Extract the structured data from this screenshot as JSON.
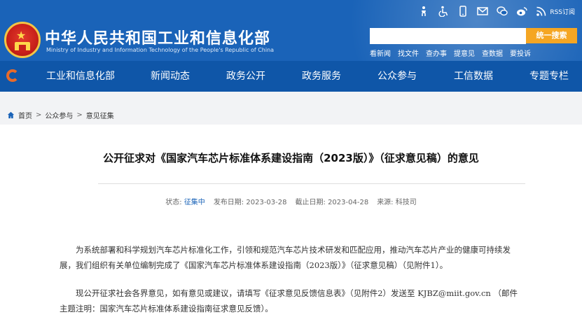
{
  "header": {
    "title": "中华人民共和国工业和信息化部",
    "subtitle": "Ministry of Industry and Information Technology of the People's Republic of China",
    "top_icons": [
      "elder-care-icon",
      "accessibility-icon",
      "mobile-icon",
      "email-icon",
      "wechat-icon",
      "weibo-icon",
      "rss-icon"
    ],
    "rss_label": "RSS订阅",
    "search": {
      "placeholder": "",
      "button_label": "统一搜索"
    },
    "quick_links": [
      "看新闻",
      "找文件",
      "查办事",
      "提意见",
      "查数据",
      "要投诉"
    ],
    "accent_color": "#f5a623",
    "header_color": "#1a63b8"
  },
  "nav": {
    "items": [
      "工业和信息化部",
      "新闻动态",
      "政务公开",
      "政务服务",
      "公众参与",
      "工信数据",
      "专题专栏"
    ],
    "color": "#0f56a8"
  },
  "breadcrumb": [
    "首页",
    "公众参与",
    "意见征集"
  ],
  "article": {
    "title": "公开征求对《国家汽车芯片标准体系建设指南（2023版）》（征求意见稿）的意见",
    "meta": {
      "status_label": "状态:",
      "status_value": "征集中",
      "publish_label": "发布日期:",
      "publish_date": "2023-03-28",
      "deadline_label": "截止日期:",
      "deadline_date": "2023-04-28",
      "source_label": "来源:",
      "source_value": "科技司"
    },
    "paragraphs": [
      "为系统部署和科学规划汽车芯片标准化工作，引领和规范汽车芯片技术研发和匹配应用，推动汽车芯片产业的健康可持续发展，我们组织有关单位编制完成了《国家汽车芯片标准体系建设指南（2023版）》（征求意见稿）（见附件1）。",
      "现公开征求社会各界意见，如有意见或建议，请填写《征求意见反馈信息表》（见附件2）发送至 KJBZ@miit.gov.cn （邮件主题注明：国家汽车芯片标准体系建设指南征求意见反馈）。"
    ]
  }
}
